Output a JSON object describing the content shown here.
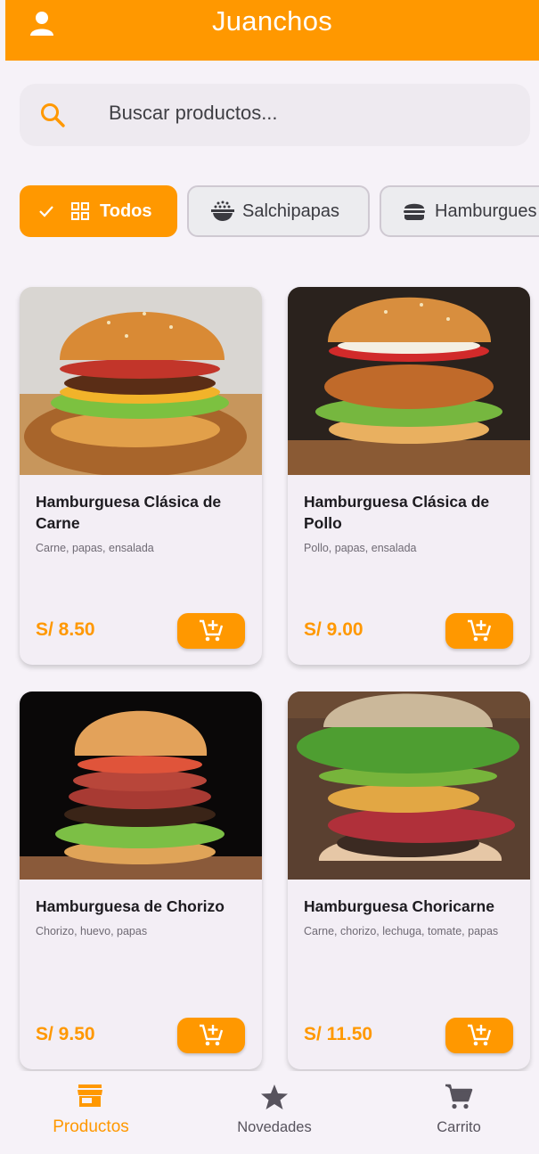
{
  "app": {
    "title": "Juanchos",
    "accent": "#ff9800"
  },
  "header": {
    "user_icon": "person-icon"
  },
  "search": {
    "placeholder": "Buscar productos...",
    "icon": "search-icon"
  },
  "categories": [
    {
      "label": "Todos",
      "selected": true,
      "icon": "grid-icon"
    },
    {
      "label": "Salchipapas",
      "selected": false,
      "icon": "rice-bowl-icon"
    },
    {
      "label": "Hamburgues",
      "selected": false,
      "icon": "burger-icon"
    }
  ],
  "products": [
    {
      "name": "Hamburguesa Clásica de Carne",
      "description": "Carne, papas, ensalada",
      "price": "S/ 8.50"
    },
    {
      "name": "Hamburguesa Clásica de Pollo",
      "description": "Pollo, papas, ensalada",
      "price": "S/ 9.00"
    },
    {
      "name": "Hamburguesa de Chorizo",
      "description": "Chorizo, huevo, papas",
      "price": "S/ 9.50"
    },
    {
      "name": "Hamburguesa Choricarne",
      "description": "Carne, chorizo, lechuga, tomate, papas",
      "price": "S/ 11.50"
    }
  ],
  "bottom_nav": [
    {
      "label": "Productos",
      "icon": "store-icon",
      "active": true
    },
    {
      "label": "Novedades",
      "icon": "star-icon",
      "active": false
    },
    {
      "label": "Carrito",
      "icon": "cart-icon",
      "active": false
    }
  ]
}
